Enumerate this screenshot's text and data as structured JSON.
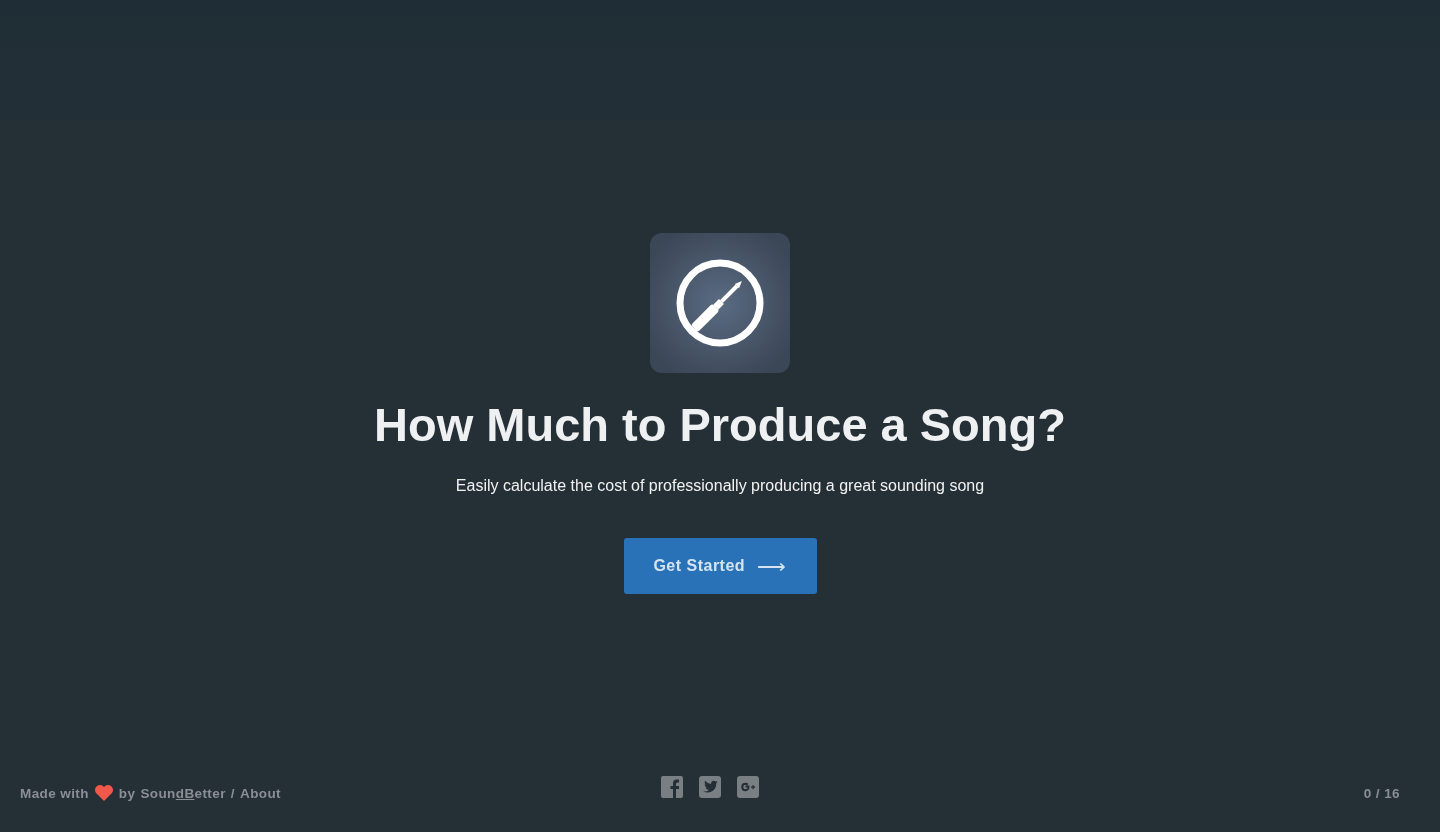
{
  "hero": {
    "title": "How Much to Produce a Song?",
    "subtitle": "Easily calculate the cost of professionally producing a great sounding song",
    "button": {
      "label": "Get Started",
      "arrow": "⟶"
    }
  },
  "footer": {
    "made_with": "Made with",
    "by": "by",
    "brand_parts": [
      "Soun",
      "dB",
      "etter"
    ],
    "separator": "/",
    "about": "About",
    "progress": "0 / 16"
  }
}
